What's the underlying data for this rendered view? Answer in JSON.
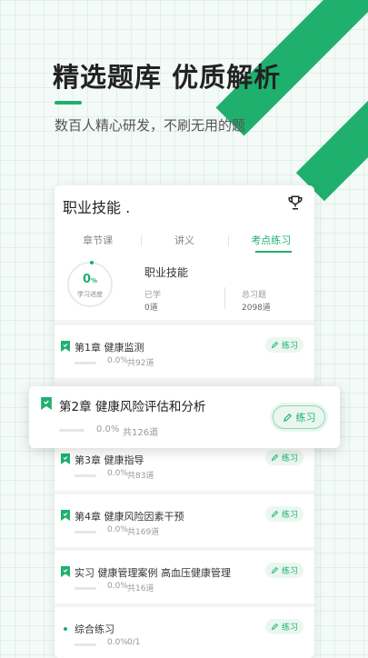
{
  "promo": {
    "headline": "精选题库  优质解析",
    "subline": "数百人精心研发，不刷无用的题"
  },
  "app": {
    "title": "职业技能 .",
    "trophy_icon": "trophy-icon",
    "tabs": [
      "章节课",
      "讲义",
      "考点练习"
    ],
    "active_tab": 2,
    "stats": {
      "progress_number": "0",
      "progress_unit": "%",
      "progress_caption": "学习进度",
      "course_name": "职业技能",
      "learned_label": "已学",
      "learned_value": "0道",
      "total_label": "总习题",
      "total_value": "2098道"
    },
    "practice_label": "练习",
    "chapters": [
      {
        "title": "第1章  健康监测",
        "pct": "0.0%",
        "count": "共92道"
      },
      {
        "title": "第2章  健康风险评估和分析",
        "pct": "0.0%",
        "count": "共126道"
      },
      {
        "title": "第3章  健康指导",
        "pct": "0.0%",
        "count": "共83道"
      },
      {
        "title": "第4章  健康风险因素干预",
        "pct": "0.0%",
        "count": "共169道"
      },
      {
        "title": "实习  健康管理案例  高血压健康管理",
        "pct": "0.0%",
        "count": "共16道"
      },
      {
        "title": "综合练习",
        "pct": "0.0%",
        "count": "0/1"
      }
    ]
  },
  "colors": {
    "accent": "#1fb06e"
  }
}
